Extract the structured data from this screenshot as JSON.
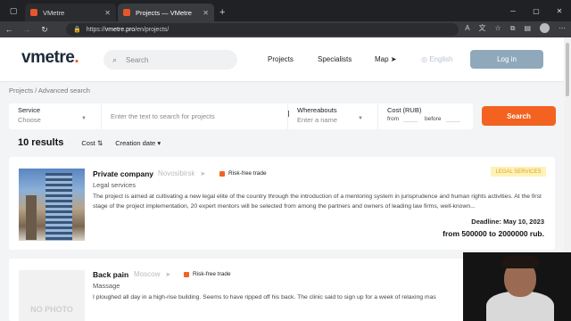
{
  "browser": {
    "tabs": [
      {
        "title": "VMetre"
      },
      {
        "title": "Projects — VMetre"
      }
    ],
    "url_prefix": "https://",
    "url_host": "vmetre.pro",
    "url_path": "/en/projects/"
  },
  "header": {
    "logo": "vmetre",
    "logo_dot": ".",
    "search_placeholder": "Search",
    "menu": {
      "projects": "Projects",
      "specialists": "Specialists",
      "map": "Map"
    },
    "language": "English",
    "login": "Log in"
  },
  "breadcrumb": "Projects / Advanced search",
  "filters": {
    "service": {
      "label": "Service",
      "value": "Choose"
    },
    "text_placeholder": "Enter the text to search for projects",
    "whereabouts": {
      "label": "Whereabouts",
      "value": "Enter a name"
    },
    "cost": {
      "label": "Cost (RUB)",
      "from": "from",
      "before": "before"
    },
    "find": "Search"
  },
  "results": {
    "count": "10 results",
    "sort_cost": "Cost",
    "sort_date": "Creation date"
  },
  "cards": [
    {
      "title": "Private company",
      "city": "Novosibirsk",
      "risk": "Risk-free trade",
      "category": "Legal services",
      "tag": "LEGAL SERVICES",
      "description": "The project is aimed at cultivating a new legal elite of the country through the introduction of a mentoring system in jurisprudence and human rights activities. At the first stage of the project implementation, 20 expert mentors will be selected from among the partners and owners of leading law firms, well-known...",
      "deadline": "Deadline: May 10, 2023",
      "price": "from 500000 to 2000000 rub."
    },
    {
      "title": "Back pain",
      "city": "Moscow",
      "risk": "Risk-free trade",
      "category": "Massage",
      "nophoto": "NO PHOTO",
      "description": "I ploughed all day in a high-rise building. Seems to have ripped off his back. The clinic said to sign up for a week of relaxing mas"
    }
  ],
  "colors": {
    "accent": "#f36221",
    "login": "#8fa9bb",
    "tag_bg": "#fdf2b8",
    "tag_text": "#e2a326"
  }
}
